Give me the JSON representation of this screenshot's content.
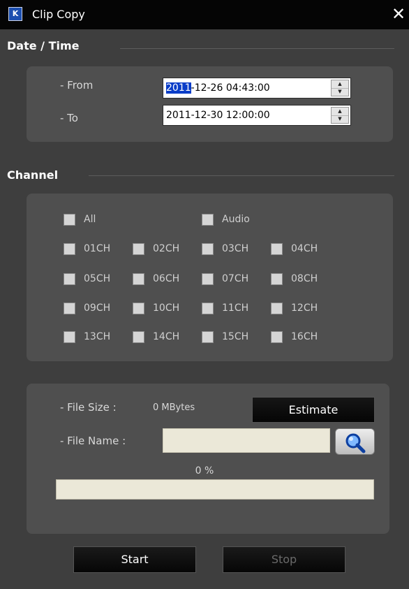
{
  "window": {
    "title": "Clip Copy",
    "icon": "app-logo-icon",
    "icon_text": "K",
    "close_glyph": "✕"
  },
  "datetime": {
    "header": "Date / Time",
    "from_label": "- From",
    "from_value_selected": "2011",
    "from_value_rest": "-12-26  04:43:00",
    "to_label": "- To",
    "to_value": "2011-12-30  12:00:00"
  },
  "channel": {
    "header": "Channel",
    "all_label": "All",
    "audio_label": "Audio",
    "channels": [
      "01CH",
      "02CH",
      "03CH",
      "04CH",
      "05CH",
      "06CH",
      "07CH",
      "08CH",
      "09CH",
      "10CH",
      "11CH",
      "12CH",
      "13CH",
      "14CH",
      "15CH",
      "16CH"
    ]
  },
  "file": {
    "size_label": "- File Size :",
    "size_value": "0 MBytes",
    "estimate_label": "Estimate",
    "name_label": "- File Name :",
    "name_value": "",
    "browse_icon": "magnifier-icon"
  },
  "progress": {
    "percent_text": "0 %",
    "value": 0
  },
  "actions": {
    "start_label": "Start",
    "stop_label": "Stop"
  },
  "colors": {
    "selection": "#0a3dc8",
    "titlebar": "#050505",
    "panel": "#4f4f4f"
  }
}
